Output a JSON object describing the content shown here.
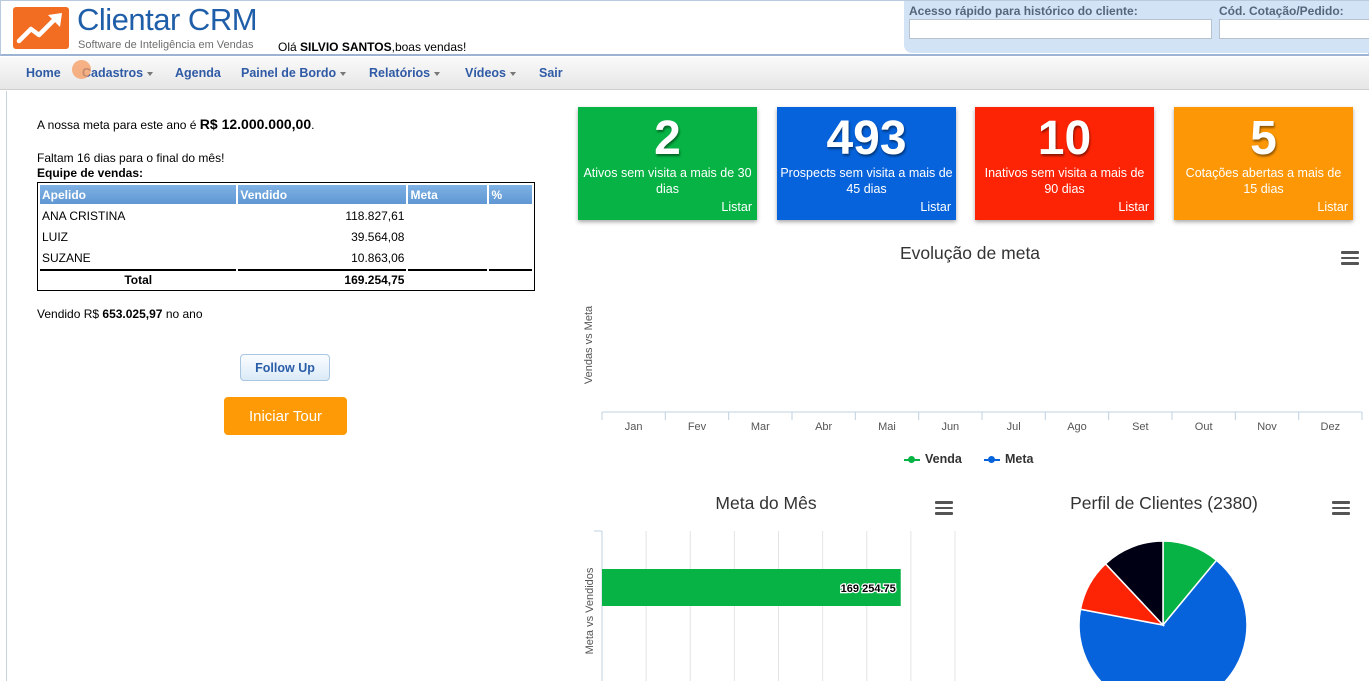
{
  "app": {
    "logo_title": "Clientar CRM",
    "logo_tagline": "Software de Inteligência em Vendas",
    "greeting_prefix": "Olá",
    "greeting_name": "SILVIO SANTOS",
    "greeting_suffix": ",boas vendas!"
  },
  "quick_access": {
    "history_label": "Acesso rápido para histórico do cliente:",
    "history_value": "",
    "quote_label": "Cód. Cotação/Pedido:",
    "quote_value": ""
  },
  "nav": {
    "items": [
      {
        "label": "Home",
        "dropdown": false
      },
      {
        "label": "Cadastros",
        "dropdown": true
      },
      {
        "label": "Agenda",
        "dropdown": false
      },
      {
        "label": "Painel de Bordo",
        "dropdown": true
      },
      {
        "label": "Relatórios",
        "dropdown": true
      },
      {
        "label": "Vídeos",
        "dropdown": true
      },
      {
        "label": "Sair",
        "dropdown": false
      }
    ]
  },
  "summary": {
    "goal_prefix": "A nossa meta para este ano é",
    "goal_value": "R$ 12.000.000,00",
    "goal_suffix": ".",
    "days_left": "Faltam 16 dias para o final do mês!",
    "team_heading": "Equipe de vendas:",
    "sold_prefix": "Vendido R$",
    "sold_value": "653.025,97",
    "sold_suffix": "no ano"
  },
  "sales_table": {
    "headers": [
      "Apelido",
      "Vendido",
      "Meta",
      "%"
    ],
    "rows": [
      {
        "name": "ANA CRISTINA",
        "sold": "118.827,61",
        "meta": "",
        "pct": ""
      },
      {
        "name": "LUIZ",
        "sold": "39.564,08",
        "meta": "",
        "pct": ""
      },
      {
        "name": "SUZANE",
        "sold": "10.863,06",
        "meta": "",
        "pct": ""
      }
    ],
    "total_label": "Total",
    "total_value": "169.254,75"
  },
  "buttons": {
    "follow_up": "Follow Up",
    "tour": "Iniciar Tour"
  },
  "kpis": [
    {
      "value": "2",
      "label": "Ativos sem visita a mais de 30 dias",
      "link": "Listar",
      "color": "#06b344"
    },
    {
      "value": "493",
      "label": "Prospects sem visita a mais de 45 dias",
      "link": "Listar",
      "color": "#0663db"
    },
    {
      "value": "10",
      "label": "Inativos sem visita a mais de 90 dias",
      "link": "Listar",
      "color": "#fd2405"
    },
    {
      "value": "5",
      "label": "Cotações abertas a mais de 15 dias",
      "link": "Listar",
      "color": "#fd9705"
    }
  ],
  "colors": {
    "link_blue": "#2f5aa5",
    "venda_green": "#06b344",
    "meta_blue": "#0663db",
    "pie_red": "#fd2405",
    "pie_black": "#000014"
  },
  "chart_data": [
    {
      "type": "line",
      "title": "Evolução de meta",
      "ylabel": "Vendas vs Meta",
      "categories": [
        "Jan",
        "Fev",
        "Mar",
        "Abr",
        "Mai",
        "Jun",
        "Jul",
        "Ago",
        "Set",
        "Out",
        "Nov",
        "Dez"
      ],
      "series": [
        {
          "name": "Venda",
          "values": [],
          "color": "#06b344"
        },
        {
          "name": "Meta",
          "values": [],
          "color": "#0663db"
        }
      ],
      "legend": "bottom-center"
    },
    {
      "type": "bar",
      "orientation": "horizontal",
      "title": "Meta do Mês",
      "ylabel": "Meta vs Vendidos",
      "categories": [
        ""
      ],
      "values": [
        169254.75
      ],
      "data_label": "169 254.75",
      "xlim": [
        0,
        200000
      ],
      "color": "#06b344",
      "grid": true
    },
    {
      "type": "pie",
      "title": "Perfil de Clientes (2380)",
      "slices": [
        {
          "value": 11,
          "color": "#06b344"
        },
        {
          "value": 67,
          "color": "#0663db"
        },
        {
          "value": 10,
          "color": "#fd2405"
        },
        {
          "value": 12,
          "color": "#000014"
        }
      ]
    }
  ]
}
